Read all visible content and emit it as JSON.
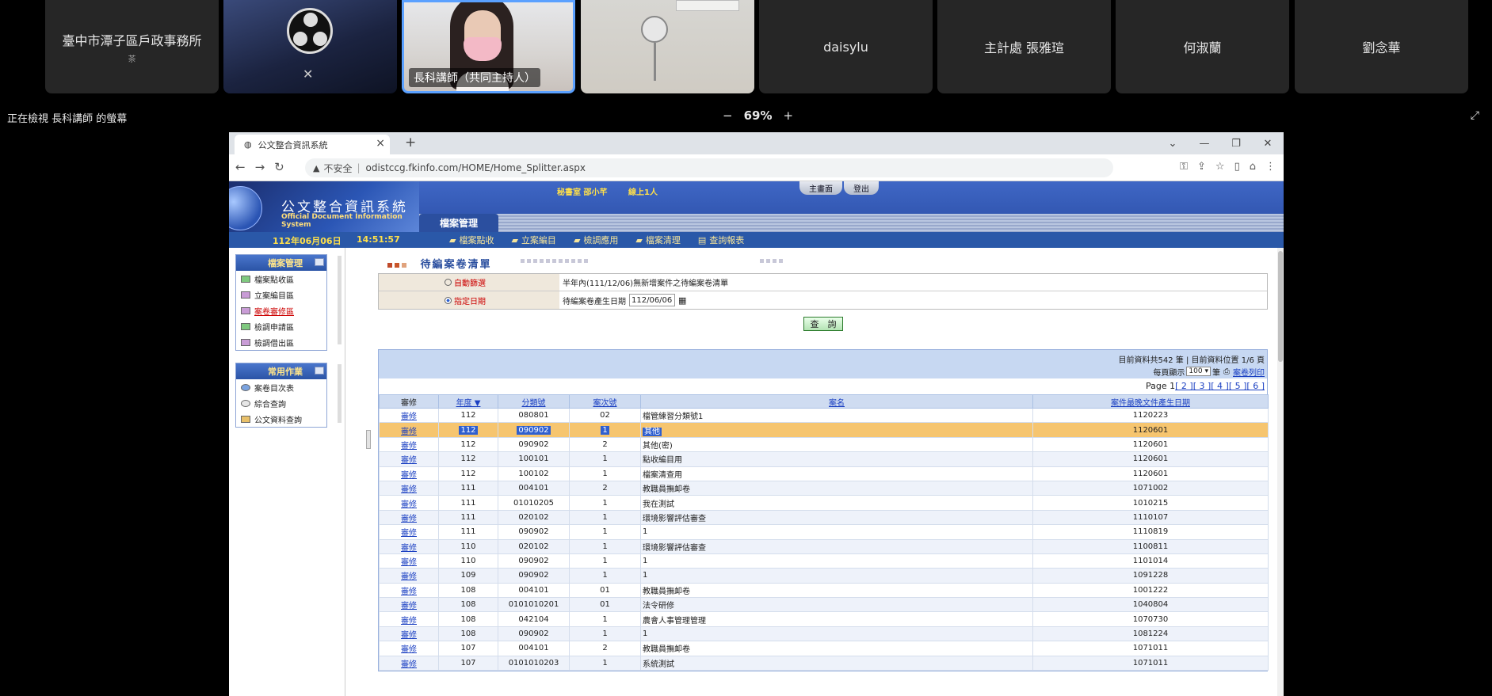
{
  "meeting": {
    "tiles": [
      {
        "name": "臺中市潭子區戶政事務所",
        "sub": "茶"
      },
      {
        "name": ""
      },
      {
        "name": "長科講師（共同主持人）"
      },
      {
        "name": ""
      },
      {
        "name": "daisylu"
      },
      {
        "name": "主計處 張雅瑄"
      },
      {
        "name": "何淑蘭"
      },
      {
        "name": "劉念華"
      }
    ],
    "viewing": "正在檢視 長科講師 的螢幕",
    "zoom_minus": "−",
    "zoom": "69%",
    "zoom_plus": "+"
  },
  "browser": {
    "tab_title": "公文整合資訊系統",
    "insecure": "不安全",
    "url": "odistccg.fkinfo.com/HOME/Home_Splitter.aspx"
  },
  "app": {
    "title_cn": "公文整合資訊系統",
    "title_en": "Official Document Information System",
    "user": "秘書室 邵小芊",
    "online": "線上1人",
    "top_buttons": [
      "主畫面",
      "登出"
    ],
    "section": "檔案管理",
    "date": "112年06月06日",
    "time": "14:51:57",
    "menu": [
      "檔案點收",
      "立案編目",
      "檢調應用",
      "檔案清理",
      "查詢報表"
    ]
  },
  "sidebar": {
    "panel1": {
      "title": "檔案管理",
      "items": [
        "檔案點收區",
        "立案編目區",
        "案卷審修區",
        "檢調申請區",
        "檢調借出區"
      ]
    },
    "panel2": {
      "title": "常用作業",
      "items": [
        "案卷目次表",
        "綜合查詢",
        "公文資料查詢"
      ]
    }
  },
  "main": {
    "title": "待編案卷清單",
    "filter": {
      "auto_label": "自動篩選",
      "auto_value": "半年內(111/12/06)無新增案件之待編案卷清單",
      "date_label": "指定日期",
      "date_value_label": "待編案卷產生日期",
      "date_value": "112/06/06"
    },
    "query_button": "查　詢",
    "result_info": "目前資料共542 筆 | 目前資料位置 1/6 頁",
    "per_page_label": "每頁顯示",
    "per_page": "100",
    "per_page_unit": "筆",
    "print_label": "案卷列印",
    "pager": {
      "current": "Page 1",
      "pages": [
        "[ 2 ]",
        "[ 3 ]",
        "[ 4 ]",
        "[ 5 ]",
        "[ 6 ]"
      ]
    },
    "columns": [
      "審修",
      "年度 ▼",
      "分類號",
      "案次號",
      "案名",
      "案件最晚文件產生日期"
    ],
    "rows": [
      [
        "審修",
        "112",
        "080801",
        "02",
        "檔管練習分類號1",
        "1120223"
      ],
      [
        "審修",
        "112",
        "090902",
        "1",
        "其他",
        "1120601"
      ],
      [
        "審修",
        "112",
        "090902",
        "2",
        "其他(密)",
        "1120601"
      ],
      [
        "審修",
        "112",
        "100101",
        "1",
        "點收編目用",
        "1120601"
      ],
      [
        "審修",
        "112",
        "100102",
        "1",
        "檔案清查用",
        "1120601"
      ],
      [
        "審修",
        "111",
        "004101",
        "2",
        "教職員撫卹卷",
        "1071002"
      ],
      [
        "審修",
        "111",
        "01010205",
        "1",
        "我在測試",
        "1010215"
      ],
      [
        "審修",
        "111",
        "020102",
        "1",
        "環境影響評估審查",
        "1110107"
      ],
      [
        "審修",
        "111",
        "090902",
        "1",
        "1",
        "1110819"
      ],
      [
        "審修",
        "110",
        "020102",
        "1",
        "環境影響評估審查",
        "1100811"
      ],
      [
        "審修",
        "110",
        "090902",
        "1",
        "1",
        "1101014"
      ],
      [
        "審修",
        "109",
        "090902",
        "1",
        "1",
        "1091228"
      ],
      [
        "審修",
        "108",
        "004101",
        "01",
        "教職員撫卹卷",
        "1001222"
      ],
      [
        "審修",
        "108",
        "0101010201",
        "01",
        "法令研修",
        "1040804"
      ],
      [
        "審修",
        "108",
        "042104",
        "1",
        "農會人事管理管理",
        "1070730"
      ],
      [
        "審修",
        "108",
        "090902",
        "1",
        "1",
        "1081224"
      ],
      [
        "審修",
        "107",
        "004101",
        "2",
        "教職員撫卹卷",
        "1071011"
      ],
      [
        "審修",
        "107",
        "0101010203",
        "1",
        "系統測試",
        "1071011"
      ]
    ]
  }
}
